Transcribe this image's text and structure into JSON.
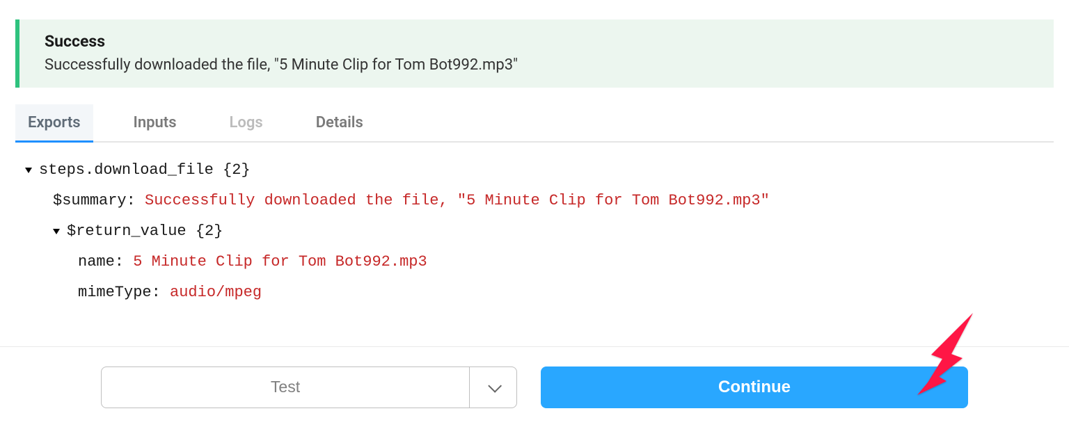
{
  "banner": {
    "title": "Success",
    "message": "Successfully downloaded the file, \"5 Minute Clip for Tom Bot992.mp3\""
  },
  "tabs": {
    "exports": "Exports",
    "inputs": "Inputs",
    "logs": "Logs",
    "details": "Details"
  },
  "tree": {
    "root_key": "steps.download_file",
    "root_count": "{2}",
    "summary_key": "$summary:",
    "summary_val": "Successfully downloaded the file, \"5 Minute Clip for Tom Bot992.mp3\"",
    "return_key": "$return_value",
    "return_count": "{2}",
    "name_key": "name:",
    "name_val": "5 Minute Clip for Tom Bot992.mp3",
    "mime_key": "mimeType:",
    "mime_val": "audio/mpeg"
  },
  "footer": {
    "test": "Test",
    "continue": "Continue"
  }
}
